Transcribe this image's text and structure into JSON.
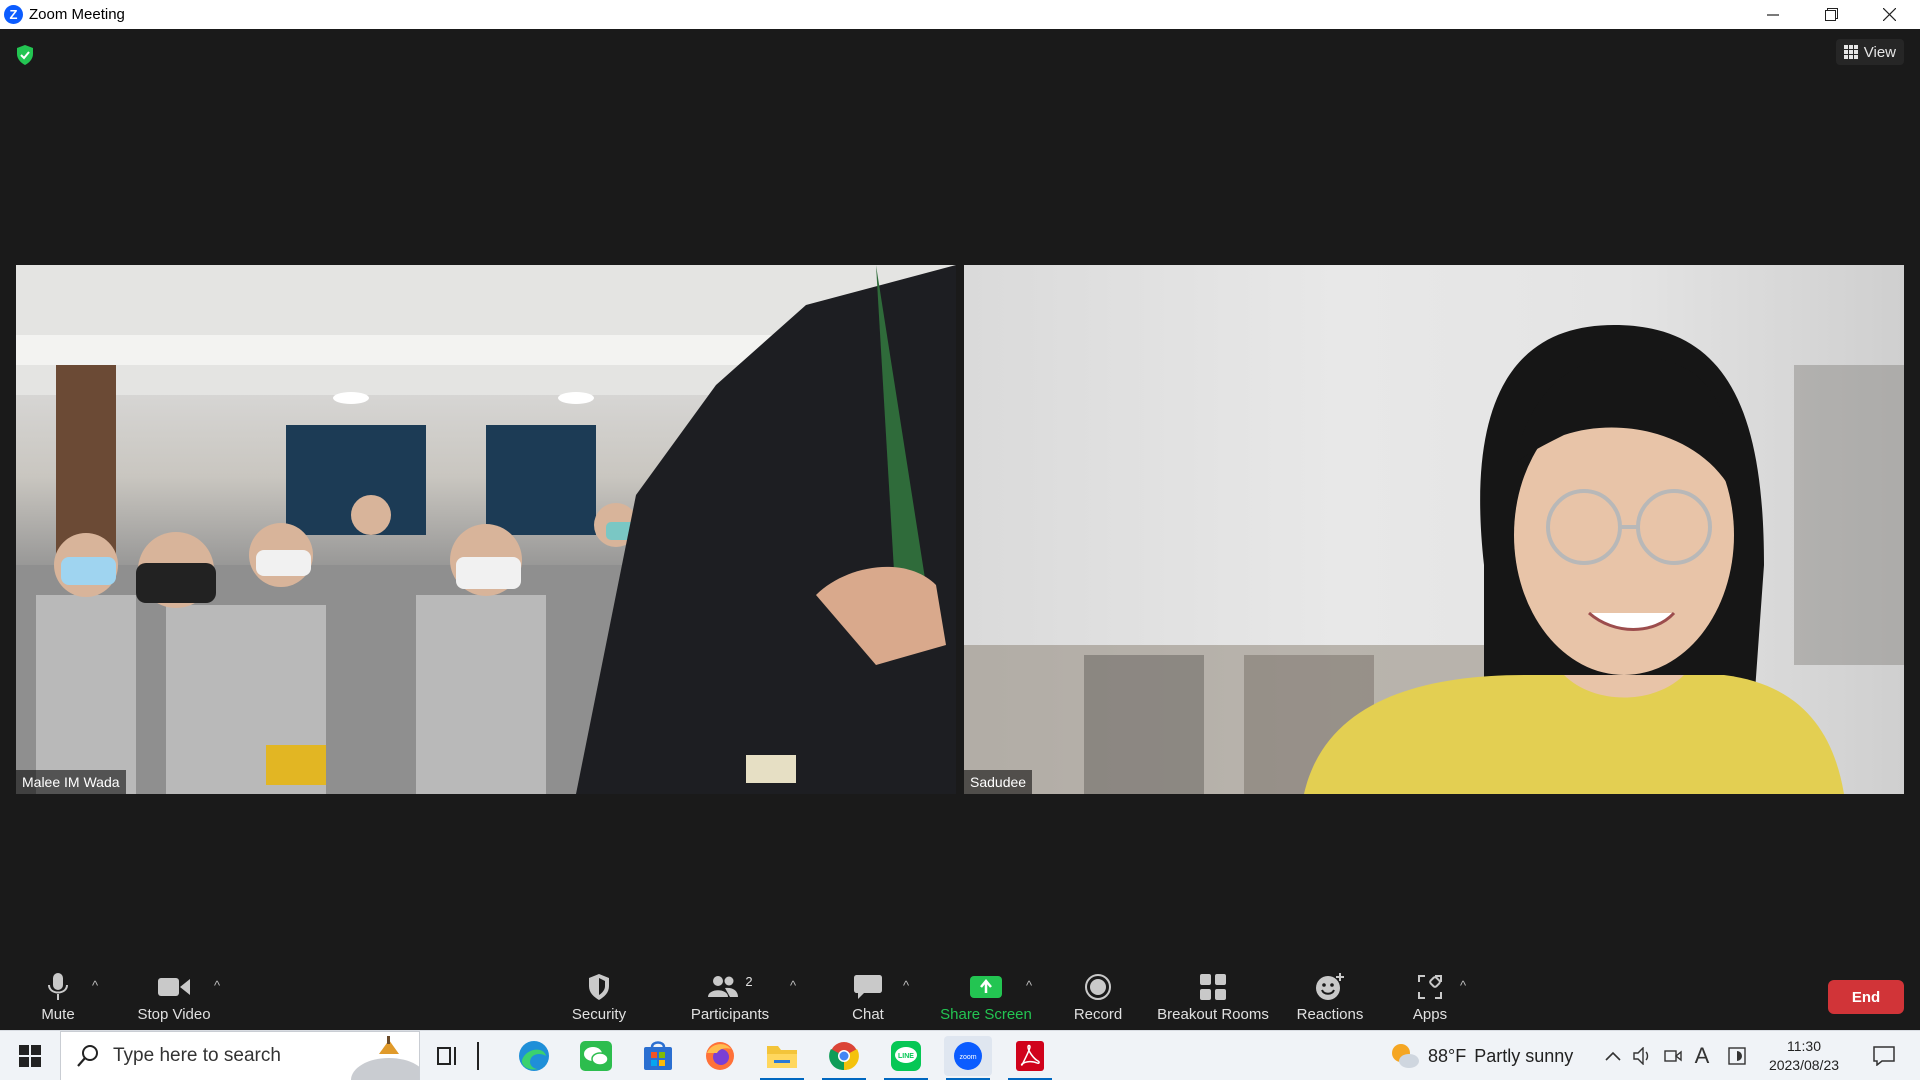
{
  "window": {
    "title": "Zoom Meeting",
    "controls": [
      "minimize",
      "restore",
      "close"
    ]
  },
  "meeting": {
    "view_label": "View",
    "security_badge": "shield-check-icon",
    "participants": [
      {
        "name": "Malee IM Wada"
      },
      {
        "name": "Sadudee"
      }
    ]
  },
  "toolbar": {
    "mute_label": "Mute",
    "stop_video_label": "Stop Video",
    "security_label": "Security",
    "participants_label": "Participants",
    "participants_count": "2",
    "chat_label": "Chat",
    "share_screen_label": "Share Screen",
    "record_label": "Record",
    "breakout_rooms_label": "Breakout Rooms",
    "reactions_label": "Reactions",
    "apps_label": "Apps",
    "end_label": "End",
    "caret": "^"
  },
  "taskbar": {
    "search_placeholder": "Type here to search",
    "apps": [
      "task-view",
      "edge",
      "wechat",
      "store",
      "firefox",
      "file-explorer",
      "chrome",
      "line",
      "zoom",
      "acrobat"
    ],
    "weather_temp": "88°F",
    "weather_desc": "Partly sunny",
    "ime_label": "A",
    "time": "11:30",
    "date": "2023/08/23"
  },
  "colors": {
    "background": "#1a1a1a",
    "share_green": "#23c552",
    "end_red": "#d13438",
    "zoom_blue": "#0b5cff"
  }
}
